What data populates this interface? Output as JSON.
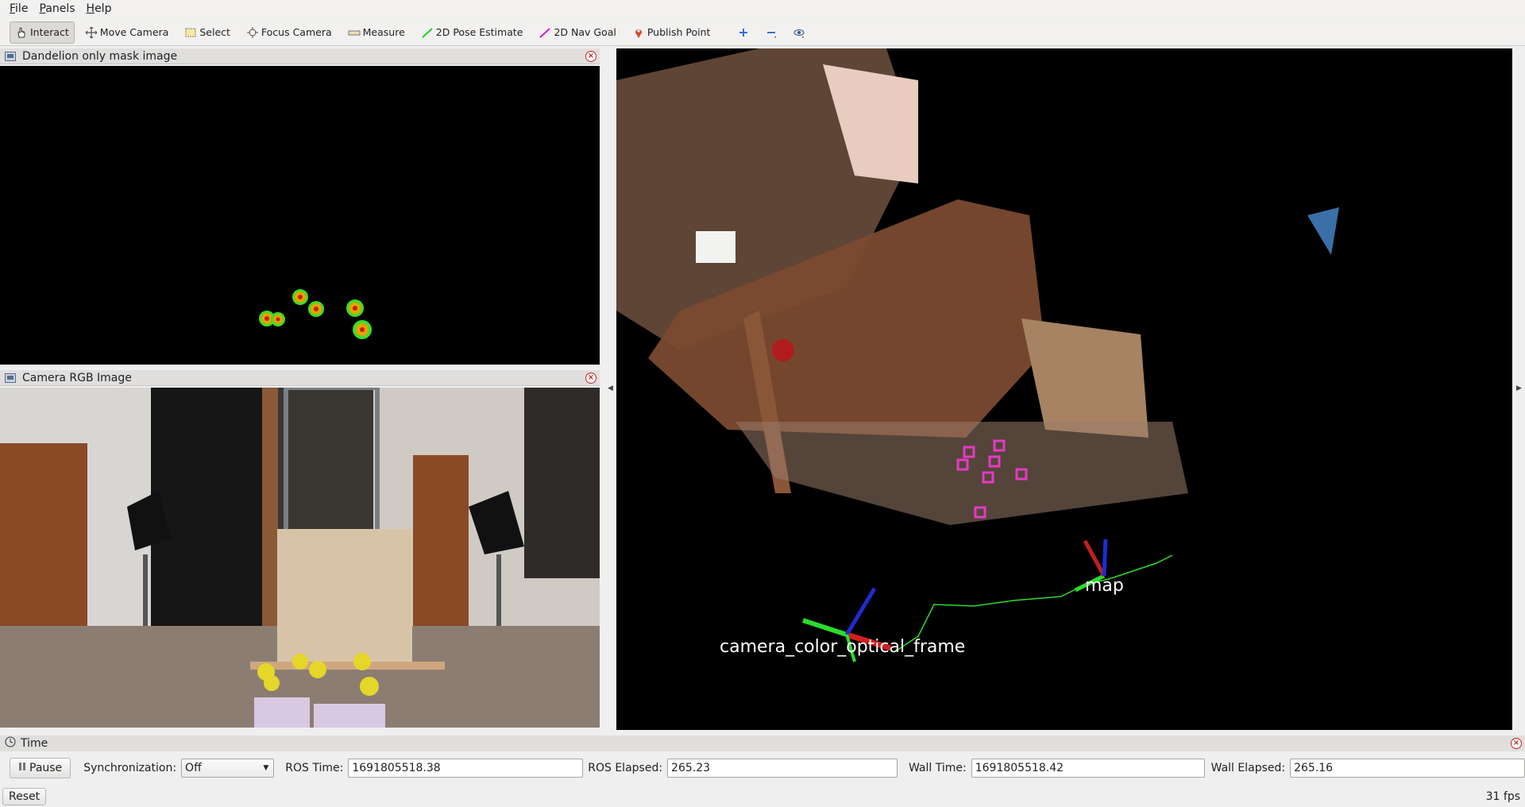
{
  "menu": [
    {
      "label": "File",
      "u": "F",
      "rest": "ile"
    },
    {
      "label": "Panels",
      "u": "P",
      "rest": "anels"
    },
    {
      "label": "Help",
      "u": "H",
      "rest": "elp"
    }
  ],
  "toolbar": {
    "interact": "Interact",
    "move_camera": "Move Camera",
    "select": "Select",
    "focus_camera": "Focus Camera",
    "measure": "Measure",
    "pose_estimate": "2D Pose Estimate",
    "nav_goal": "2D Nav Goal",
    "publish_point": "Publish Point"
  },
  "mask_panel": {
    "title": "Dandelion only mask image"
  },
  "rgb_panel": {
    "title": "Camera RGB Image"
  },
  "view3d": {
    "frame_label_map": "map",
    "frame_label_camera": "camera_color_optical_frame"
  },
  "time_panel": {
    "title": "Time",
    "pause_label": "Pause",
    "sync_label": "Synchronization:",
    "sync_value": "Off",
    "ros_time_label": "ROS Time:",
    "ros_time_value": "1691805518.38",
    "ros_elapsed_label": "ROS Elapsed:",
    "ros_elapsed_value": "265.23",
    "wall_time_label": "Wall Time:",
    "wall_time_value": "1691805518.42",
    "wall_elapsed_label": "Wall Elapsed:",
    "wall_elapsed_value": "265.16"
  },
  "status": {
    "reset_label": "Reset",
    "fps": "31 fps"
  },
  "colors": {
    "accent_close": "#c41f1f",
    "path_green": "#2bdc2b",
    "mask_green": "#3adf2a"
  }
}
